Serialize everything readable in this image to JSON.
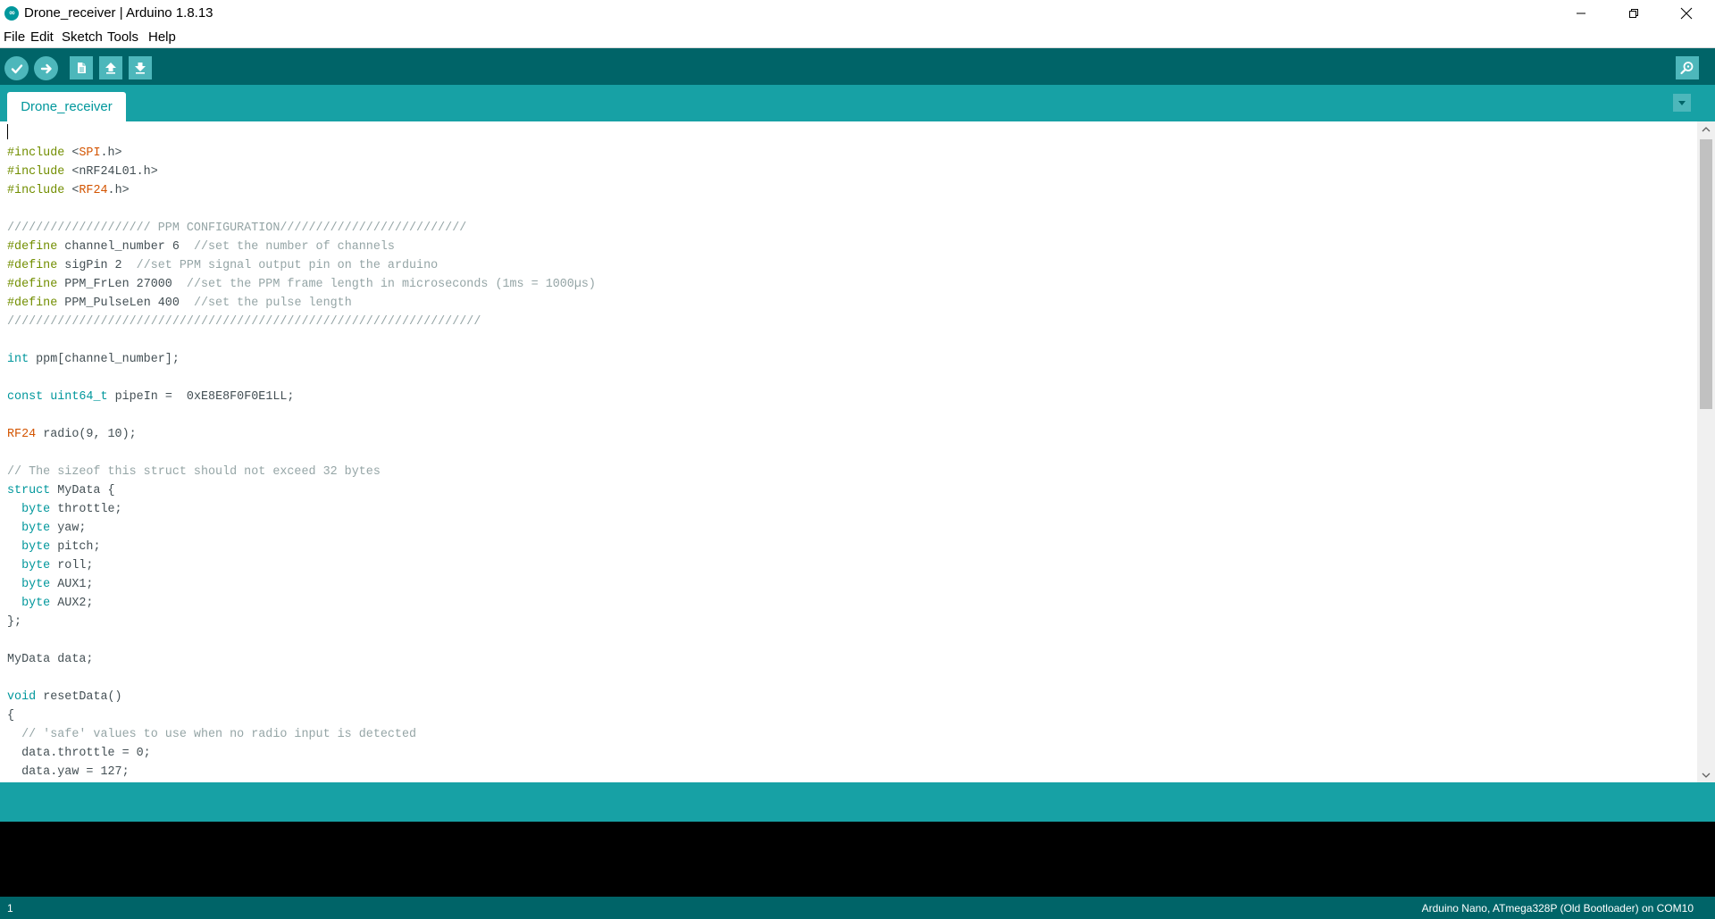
{
  "window": {
    "title": "Drone_receiver | Arduino 1.8.13",
    "logo_text": "∞"
  },
  "menu": [
    {
      "label": "File"
    },
    {
      "label": "Edit"
    },
    {
      "label": "Sketch"
    },
    {
      "label": "Tools"
    },
    {
      "label": "Help"
    }
  ],
  "toolbar": {
    "buttons": [
      "check-icon",
      "arrow-right-icon",
      "new-file-icon",
      "arrow-up-icon",
      "arrow-down-icon"
    ],
    "serial_monitor_icon": "magnifier-icon"
  },
  "tabs": [
    {
      "label": "Drone_receiver",
      "active": true
    }
  ],
  "editor": {
    "lines": [
      [
        {
          "t": "#include ",
          "c": "kw"
        },
        {
          "t": "<",
          "c": ""
        },
        {
          "t": "SPI",
          "c": "lb"
        },
        {
          "t": ".h>",
          "c": ""
        }
      ],
      [
        {
          "t": "#include ",
          "c": "kw"
        },
        {
          "t": "<nRF24L01.h>",
          "c": ""
        }
      ],
      [
        {
          "t": "#include ",
          "c": "kw"
        },
        {
          "t": "<",
          "c": ""
        },
        {
          "t": "RF24",
          "c": "lb"
        },
        {
          "t": ".h>",
          "c": ""
        }
      ],
      [],
      [
        {
          "t": "//////////////////// PPM CONFIGURATION//////////////////////////",
          "c": "cm"
        }
      ],
      [
        {
          "t": "#define ",
          "c": "kw"
        },
        {
          "t": "channel_number 6  ",
          "c": ""
        },
        {
          "t": "//set the number of channels",
          "c": "cm"
        }
      ],
      [
        {
          "t": "#define ",
          "c": "kw"
        },
        {
          "t": "sigPin 2  ",
          "c": ""
        },
        {
          "t": "//set PPM signal output pin on the arduino",
          "c": "cm"
        }
      ],
      [
        {
          "t": "#define ",
          "c": "kw"
        },
        {
          "t": "PPM_FrLen 27000  ",
          "c": ""
        },
        {
          "t": "//set the PPM frame length in microseconds (1ms = 1000µs)",
          "c": "cm"
        }
      ],
      [
        {
          "t": "#define ",
          "c": "kw"
        },
        {
          "t": "PPM_PulseLen 400  ",
          "c": ""
        },
        {
          "t": "//set the pulse length",
          "c": "cm"
        }
      ],
      [
        {
          "t": "//////////////////////////////////////////////////////////////////",
          "c": "cm"
        }
      ],
      [],
      [
        {
          "t": "int",
          "c": "ty"
        },
        {
          "t": " ppm[channel_number];",
          "c": ""
        }
      ],
      [],
      [
        {
          "t": "const",
          "c": "ty"
        },
        {
          "t": " ",
          "c": ""
        },
        {
          "t": "uint64_t",
          "c": "ty"
        },
        {
          "t": " pipeIn =  0xE8E8F0F0E1LL;",
          "c": ""
        }
      ],
      [],
      [
        {
          "t": "RF24",
          "c": "lb"
        },
        {
          "t": " radio(9, 10);",
          "c": ""
        }
      ],
      [],
      [
        {
          "t": "// The sizeof this struct should not exceed 32 bytes",
          "c": "cm"
        }
      ],
      [
        {
          "t": "struct",
          "c": "ty"
        },
        {
          "t": " MyData {",
          "c": ""
        }
      ],
      [
        {
          "t": "  ",
          "c": ""
        },
        {
          "t": "byte",
          "c": "ty"
        },
        {
          "t": " throttle;",
          "c": ""
        }
      ],
      [
        {
          "t": "  ",
          "c": ""
        },
        {
          "t": "byte",
          "c": "ty"
        },
        {
          "t": " yaw;",
          "c": ""
        }
      ],
      [
        {
          "t": "  ",
          "c": ""
        },
        {
          "t": "byte",
          "c": "ty"
        },
        {
          "t": " pitch;",
          "c": ""
        }
      ],
      [
        {
          "t": "  ",
          "c": ""
        },
        {
          "t": "byte",
          "c": "ty"
        },
        {
          "t": " roll;",
          "c": ""
        }
      ],
      [
        {
          "t": "  ",
          "c": ""
        },
        {
          "t": "byte",
          "c": "ty"
        },
        {
          "t": " AUX1;",
          "c": ""
        }
      ],
      [
        {
          "t": "  ",
          "c": ""
        },
        {
          "t": "byte",
          "c": "ty"
        },
        {
          "t": " AUX2;",
          "c": ""
        }
      ],
      [
        {
          "t": "};",
          "c": ""
        }
      ],
      [],
      [
        {
          "t": "MyData data;",
          "c": ""
        }
      ],
      [],
      [
        {
          "t": "void",
          "c": "ty"
        },
        {
          "t": " resetData()",
          "c": ""
        }
      ],
      [
        {
          "t": "{",
          "c": ""
        }
      ],
      [
        {
          "t": "  ",
          "c": ""
        },
        {
          "t": "// 'safe' values to use when no radio input is detected",
          "c": "cm"
        }
      ],
      [
        {
          "t": "  data.throttle = 0;",
          "c": ""
        }
      ],
      [
        {
          "t": "  data.yaw = 127;",
          "c": ""
        }
      ]
    ]
  },
  "status": {
    "line": "1",
    "board": "Arduino Nano, ATmega328P (Old Bootloader) on COM10"
  },
  "colors": {
    "toolbar": "#006468",
    "tabbar": "#17a1a5",
    "button": "#4db7bb",
    "keyword": "#728e00",
    "type": "#00979c",
    "library": "#d35400",
    "comment": "#95a5a6"
  }
}
